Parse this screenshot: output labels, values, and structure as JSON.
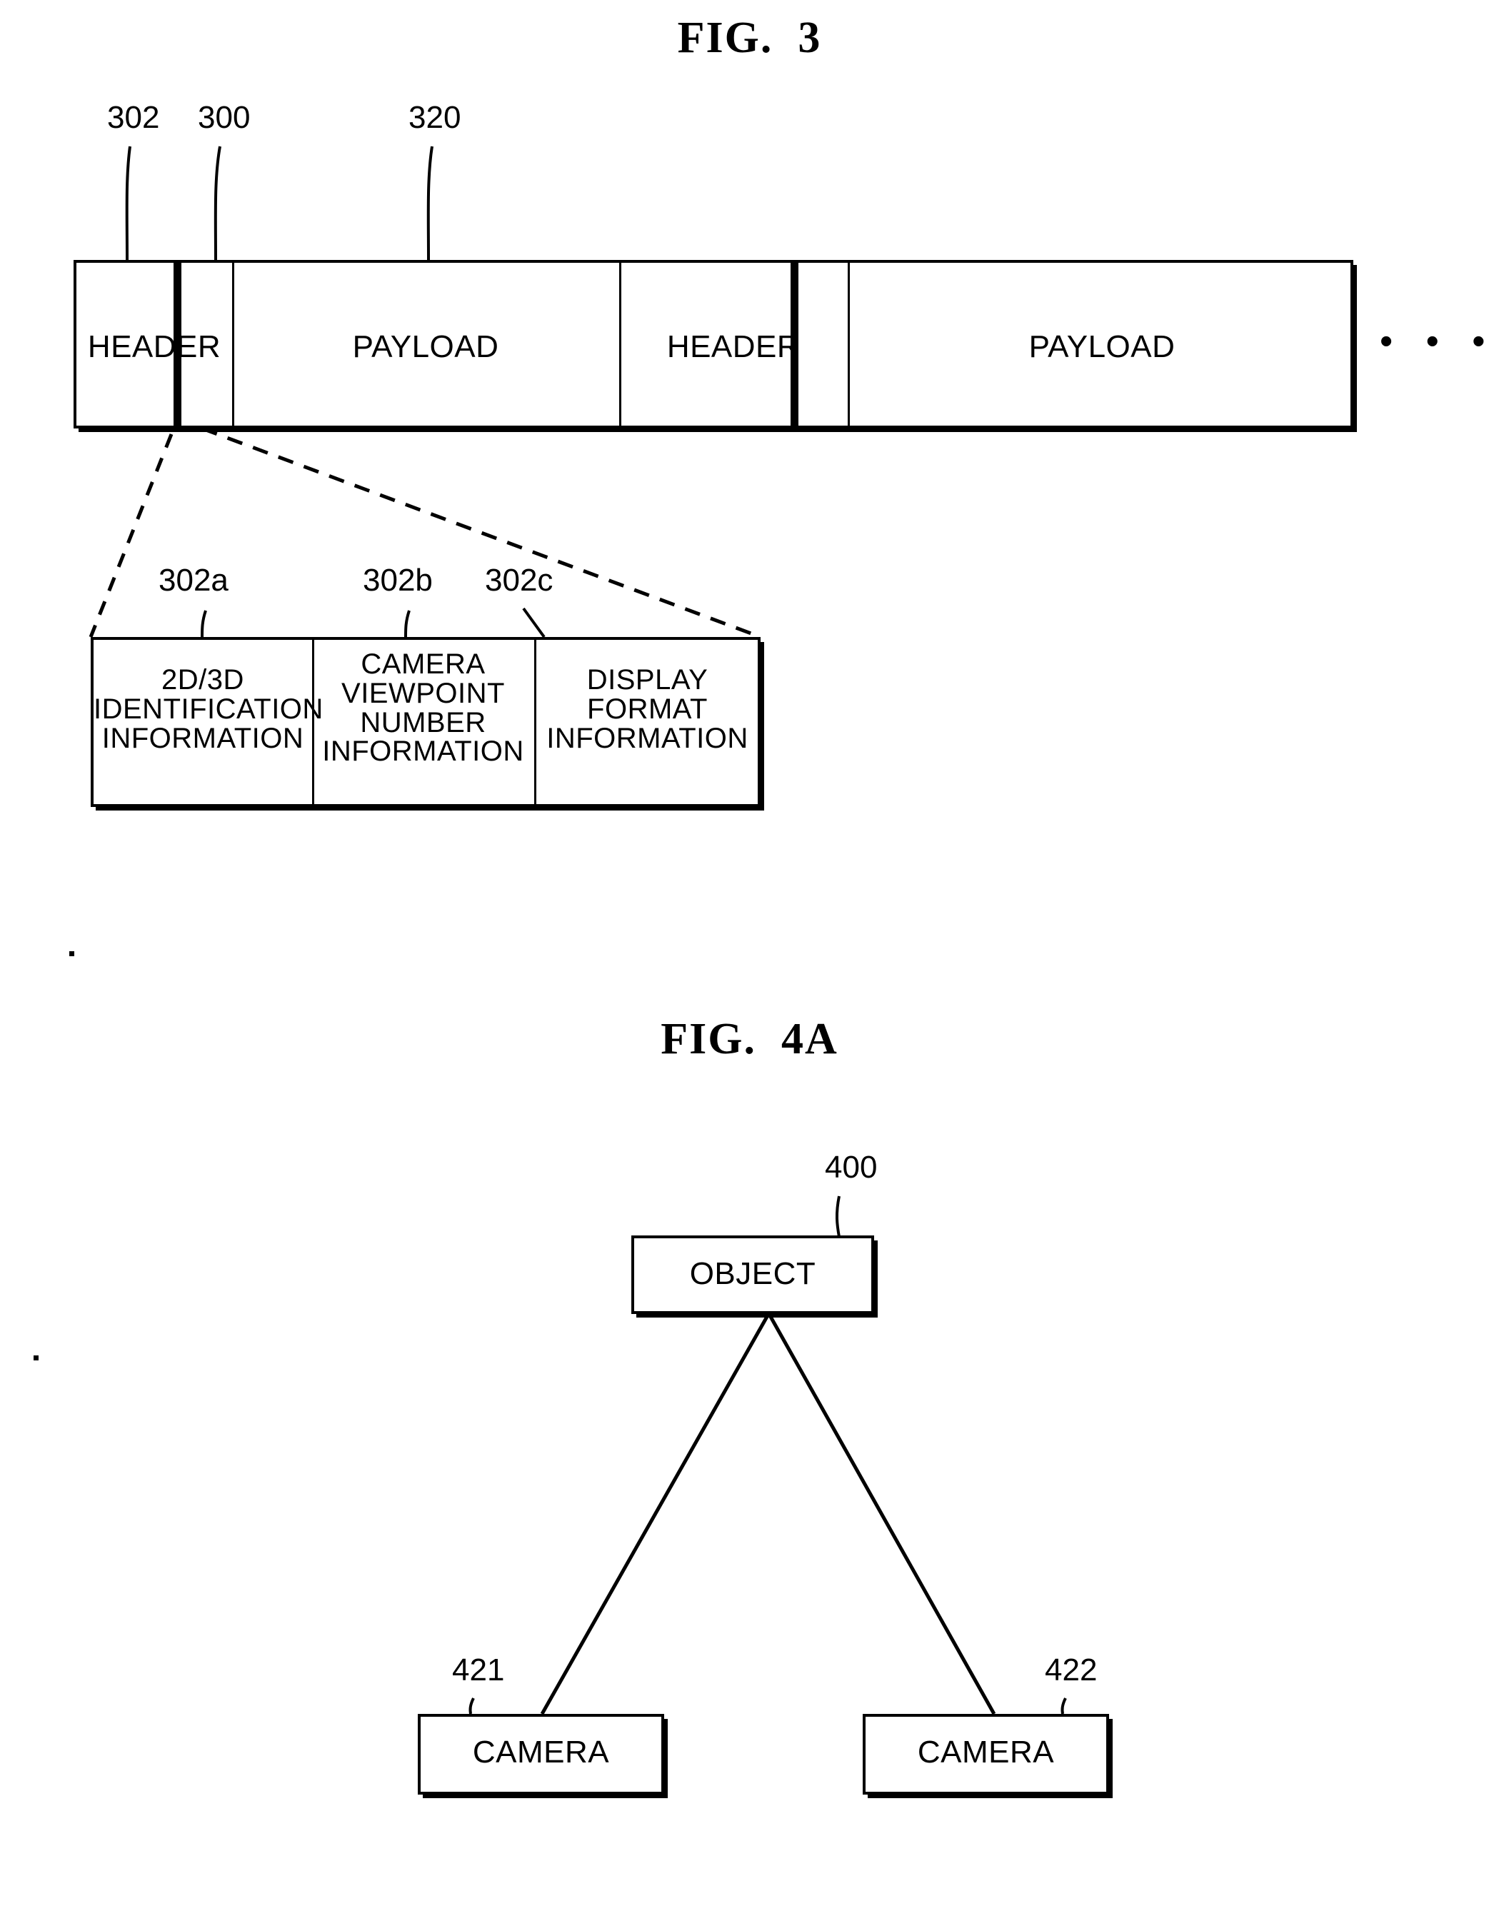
{
  "figures": [
    {
      "id": "fig3",
      "title": "FIG.  3",
      "packet_stream": {
        "refs": [
          {
            "id": "302",
            "label": "302"
          },
          {
            "id": "300",
            "label": "300"
          },
          {
            "id": "320",
            "label": "320"
          }
        ],
        "cells": [
          {
            "id": "header-1",
            "label": "HEADER"
          },
          {
            "id": "payload-1",
            "label": "PAYLOAD"
          },
          {
            "id": "header-2",
            "label": "HEADER"
          },
          {
            "id": "payload-2",
            "label": "PAYLOAD"
          }
        ],
        "continuation": "• • •"
      },
      "header_detail": {
        "refs": [
          {
            "id": "302a",
            "label": "302a"
          },
          {
            "id": "302b",
            "label": "302b"
          },
          {
            "id": "302c",
            "label": "302c"
          }
        ],
        "fields": [
          {
            "id": "302a",
            "label": "2D/3D\nIDENTIFICATION\nINFORMATION"
          },
          {
            "id": "302b",
            "label": "CAMERA\nVIEWPOINT\nNUMBER\nINFORMATION"
          },
          {
            "id": "302c",
            "label": "DISPLAY\nFORMAT\nINFORMATION"
          }
        ]
      }
    },
    {
      "id": "fig4a",
      "title": "FIG.  4A",
      "nodes": [
        {
          "id": "object",
          "label": "OBJECT",
          "ref": "400"
        },
        {
          "id": "camera-left",
          "label": "CAMERA",
          "ref": "421"
        },
        {
          "id": "camera-right",
          "label": "CAMERA",
          "ref": "422"
        }
      ]
    }
  ],
  "colors": {
    "ink": "#000000",
    "paper": "#ffffff"
  }
}
